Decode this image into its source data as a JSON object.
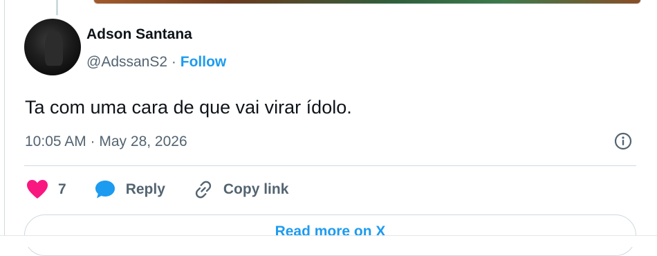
{
  "author": {
    "display_name": "Adson Santana",
    "handle": "@AdssanS2",
    "separator": "·",
    "follow_label": "Follow"
  },
  "tweet": {
    "text": "Ta com uma cara de que vai virar ídolo.",
    "timestamp": "10:05 AM · May 28, 2026"
  },
  "actions": {
    "like_count": "7",
    "reply_label": "Reply",
    "copy_link_label": "Copy link"
  },
  "footer": {
    "read_more_label": "Read more on X"
  },
  "icons": {
    "like": "heart-icon",
    "reply": "speech-bubble-icon",
    "copy_link": "link-icon",
    "info": "info-icon"
  },
  "colors": {
    "accent": "#1d9bf0",
    "like": "#f91880",
    "text": "#0f1419",
    "muted": "#536471",
    "border": "#cfd9de"
  }
}
